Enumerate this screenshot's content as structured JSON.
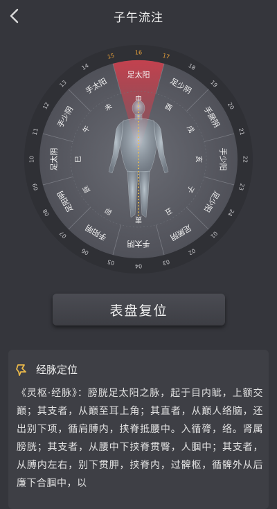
{
  "nav": {
    "title": "子午流注",
    "back_icon": "chevron-left-icon"
  },
  "dial": {
    "hours": [
      "16",
      "17",
      "18",
      "19",
      "20",
      "21",
      "22",
      "23",
      "24",
      "01",
      "02",
      "03",
      "04",
      "05",
      "06",
      "07",
      "08",
      "09",
      "10",
      "11",
      "12",
      "13",
      "14",
      "15"
    ],
    "highlight_hours": [
      "15",
      "16",
      "17"
    ],
    "highlight_color": "#e8a13a",
    "meridians": [
      "足太阳",
      "足少阴",
      "手厥阴",
      "手少阳",
      "足少阳",
      "足厥阴",
      "手太阴",
      "手阳明",
      "足阳明",
      "足太阴",
      "手少阴",
      "手太阳"
    ],
    "branches": [
      "申",
      "酉",
      "戌",
      "亥",
      "子",
      "丑",
      "寅",
      "卯",
      "辰",
      "巳",
      "午",
      "未"
    ],
    "active_sector_color": "#c9414e"
  },
  "reset_button": {
    "label": "表盘复位"
  },
  "card": {
    "icon": "pin-icon",
    "icon_color": "#e9b84a",
    "title": "经脉定位",
    "body": "《灵枢·经脉》：膀胱足太阳之脉，起于目内眦，上额交巅；其支者，从巅至耳上角；其直者，从巅人络脑，还出别下项，循肩膊内，挟脊抵腰中。入循膂，络。肾属膀胱；其支者，从腰中下挟脊贯臀，人腘中；其支者，从膊内左右，别下贯胛，挟脊内，过髀枢，循髀外从后廉下合腘中，以"
  }
}
